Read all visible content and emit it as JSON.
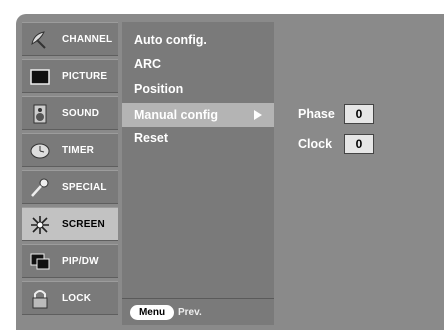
{
  "left_menu": [
    {
      "label": "CHANNEL",
      "icon": "satellite-dish-icon",
      "selected": false
    },
    {
      "label": "PICTURE",
      "icon": "tv-screen-icon",
      "selected": false
    },
    {
      "label": "SOUND",
      "icon": "speaker-icon",
      "selected": false
    },
    {
      "label": "TIMER",
      "icon": "clock-icon",
      "selected": false
    },
    {
      "label": "SPECIAL",
      "icon": "key-icon",
      "selected": false
    },
    {
      "label": "SCREEN",
      "icon": "crosshair-arrows-icon",
      "selected": true
    },
    {
      "label": "PIP/DW",
      "icon": "pip-windows-icon",
      "selected": false
    },
    {
      "label": "LOCK",
      "icon": "padlock-icon",
      "selected": false
    }
  ],
  "submenu": {
    "items": [
      {
        "label": "Auto config.",
        "selected": false
      },
      {
        "label": "ARC",
        "selected": false
      },
      {
        "label": "Position",
        "selected": false
      },
      {
        "label": "Manual config",
        "selected": true,
        "has_arrow": true
      },
      {
        "label": "Reset",
        "selected": false
      }
    ],
    "footer": {
      "menu_button": "Menu",
      "prev_label": "Prev."
    }
  },
  "settings": [
    {
      "label": "Phase",
      "value": "0"
    },
    {
      "label": "Clock",
      "value": "0"
    }
  ],
  "colors": {
    "panel": "#7a7a7a",
    "selected": "#c2c2c2",
    "background": "#8a8a8a"
  }
}
